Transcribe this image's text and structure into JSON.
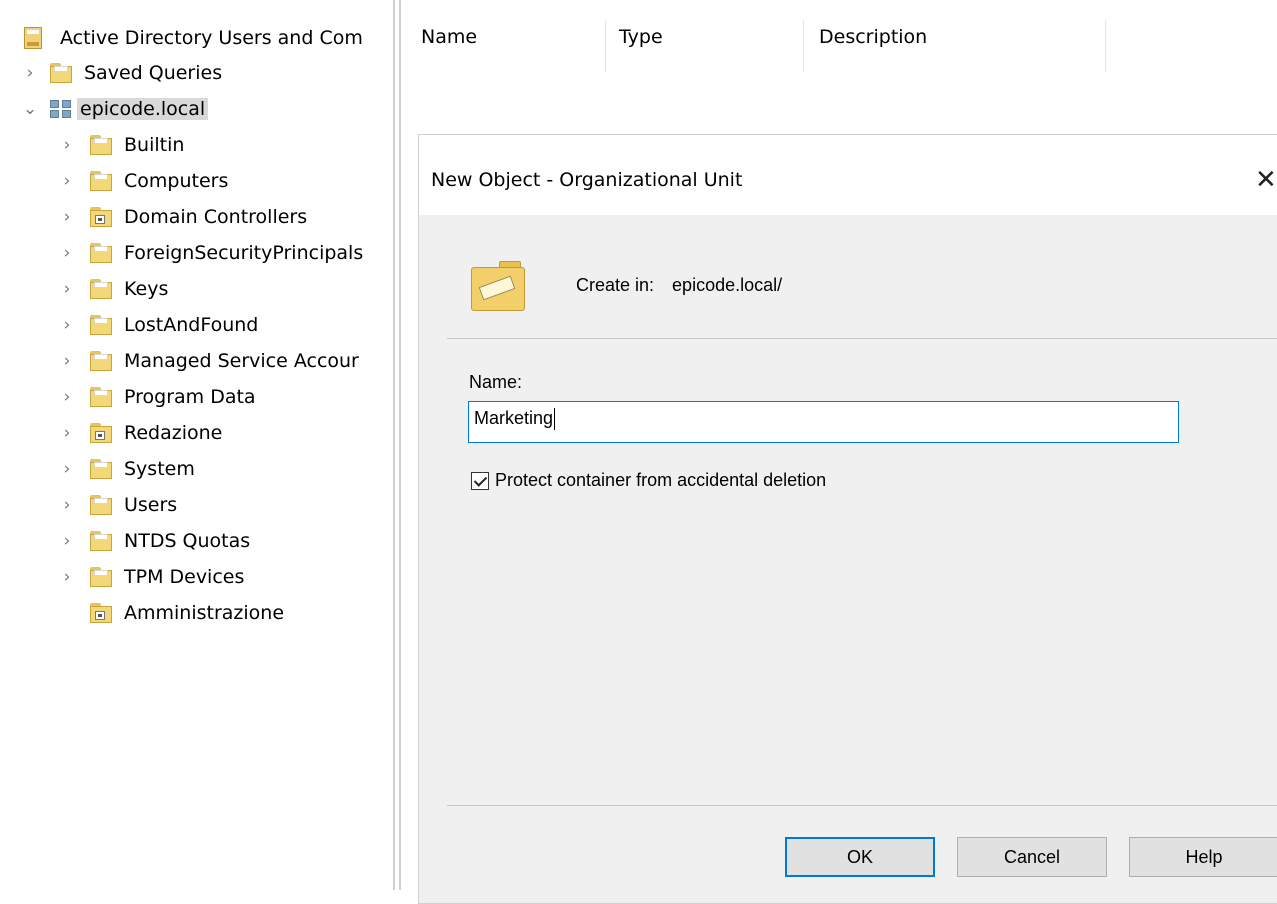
{
  "tree": {
    "root_label": "Active Directory Users and Com",
    "saved_queries": "Saved Queries",
    "domain": "epicode.local",
    "children": [
      {
        "label": "Builtin"
      },
      {
        "label": "Computers"
      },
      {
        "label": "Domain Controllers"
      },
      {
        "label": "ForeignSecurityPrincipals"
      },
      {
        "label": "Keys"
      },
      {
        "label": "LostAndFound"
      },
      {
        "label": "Managed Service Accour"
      },
      {
        "label": "Program Data"
      },
      {
        "label": "Redazione"
      },
      {
        "label": "System"
      },
      {
        "label": "Users"
      },
      {
        "label": "NTDS Quotas"
      },
      {
        "label": "TPM Devices"
      },
      {
        "label": "Amministrazione"
      }
    ]
  },
  "list": {
    "columns": [
      "Name",
      "Type",
      "Description"
    ]
  },
  "dialog": {
    "title": "New Object - Organizational Unit",
    "close_glyph": "✕",
    "create_in_label": "Create in:",
    "create_in_value": "epicode.local/",
    "name_label": "Name:",
    "name_value": "Marketing",
    "protect_label": "Protect container from accidental deletion",
    "protect_checked": true,
    "ok_label": "OK",
    "cancel_label": "Cancel",
    "help_label": "Help"
  },
  "icons": {
    "expand": "chevron-right-icon",
    "collapse": "chevron-down-icon",
    "folder": "folder-icon",
    "ou": "organizational-unit-icon",
    "domain": "domain-icon"
  },
  "colors": {
    "accent": "#0078d7",
    "selection": "#d9d9d9",
    "dialog_bg": "#f0f0f0"
  }
}
